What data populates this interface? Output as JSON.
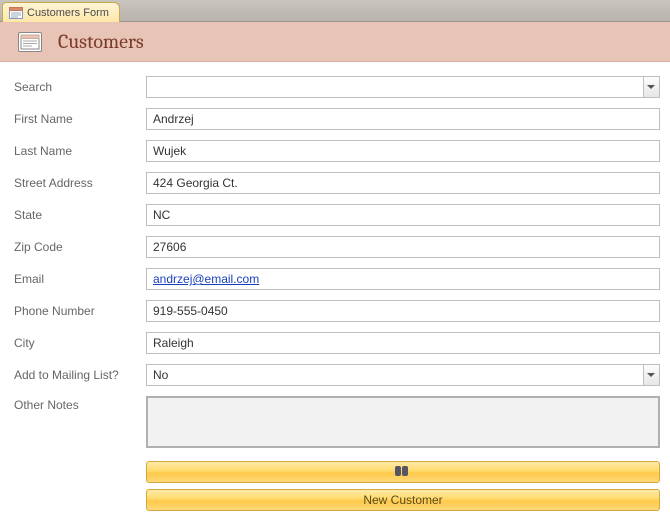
{
  "tab": {
    "label": "Customers Form"
  },
  "header": {
    "title": "Customers"
  },
  "labels": {
    "search": "Search",
    "first_name": "First Name",
    "last_name": "Last Name",
    "street_address": "Street Address",
    "state": "State",
    "zip_code": "Zip Code",
    "email": "Email",
    "phone_number": "Phone Number",
    "city": "City",
    "mailing_list": "Add to Mailing List?",
    "other_notes": "Other Notes"
  },
  "values": {
    "search": "",
    "first_name": "Andrzej",
    "last_name": "Wujek",
    "street_address": "424 Georgia Ct.",
    "state": "NC",
    "zip_code": "27606",
    "email": "andrzej@email.com",
    "phone_number": "919-555-0450",
    "city": "Raleigh",
    "mailing_list": "No",
    "other_notes": ""
  },
  "buttons": {
    "find": "",
    "new_customer": "New Customer"
  }
}
